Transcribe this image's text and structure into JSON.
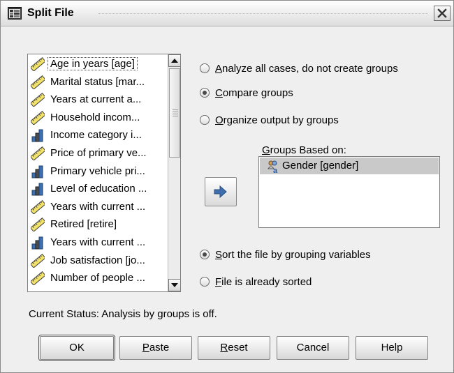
{
  "window": {
    "title": "Split File"
  },
  "variables": [
    {
      "label": "Age in years [age]",
      "icon": "scale-ruler-icon"
    },
    {
      "label": "Marital status [mar...",
      "icon": "scale-ruler-icon"
    },
    {
      "label": "Years at current a...",
      "icon": "scale-ruler-icon"
    },
    {
      "label": "Household incom...",
      "icon": "scale-ruler-icon"
    },
    {
      "label": "Income category i...",
      "icon": "ordinal-bars-icon"
    },
    {
      "label": "Price of primary ve...",
      "icon": "scale-ruler-icon"
    },
    {
      "label": "Primary vehicle pri...",
      "icon": "ordinal-bars-icon"
    },
    {
      "label": "Level of education ...",
      "icon": "ordinal-bars-icon"
    },
    {
      "label": "Years with current ...",
      "icon": "scale-ruler-icon"
    },
    {
      "label": "Retired [retire]",
      "icon": "scale-ruler-icon"
    },
    {
      "label": "Years with current ...",
      "icon": "ordinal-bars-icon"
    },
    {
      "label": "Job satisfaction [jo...",
      "icon": "scale-ruler-icon"
    },
    {
      "label": "Number of people ...",
      "icon": "scale-ruler-icon"
    }
  ],
  "options": {
    "analyze_all": {
      "prefix": "",
      "mnemonic": "A",
      "rest": "nalyze all cases, do not create groups",
      "selected": false
    },
    "compare": {
      "prefix": "",
      "mnemonic": "C",
      "rest": "ompare groups",
      "selected": true
    },
    "organize": {
      "prefix": "",
      "mnemonic": "O",
      "rest": "rganize output by groups",
      "selected": false
    }
  },
  "groups": {
    "label_mnemonic": "G",
    "label_rest": "roups Based on:",
    "items": [
      {
        "label": "Gender [gender]",
        "icon": "nominal-var-icon"
      }
    ]
  },
  "sorting": {
    "sort_by_grouping": {
      "mnemonic": "S",
      "rest": "ort the file by grouping variables",
      "selected": true
    },
    "already_sorted": {
      "mnemonic": "F",
      "rest": "ile is already sorted",
      "selected": false
    }
  },
  "status": "Current Status: Analysis by groups is off.",
  "buttons": {
    "ok": "OK",
    "paste_mnemonic": "P",
    "paste_rest": "aste",
    "reset_mnemonic": "R",
    "reset_rest": "eset",
    "cancel": "Cancel",
    "help": "Help"
  }
}
